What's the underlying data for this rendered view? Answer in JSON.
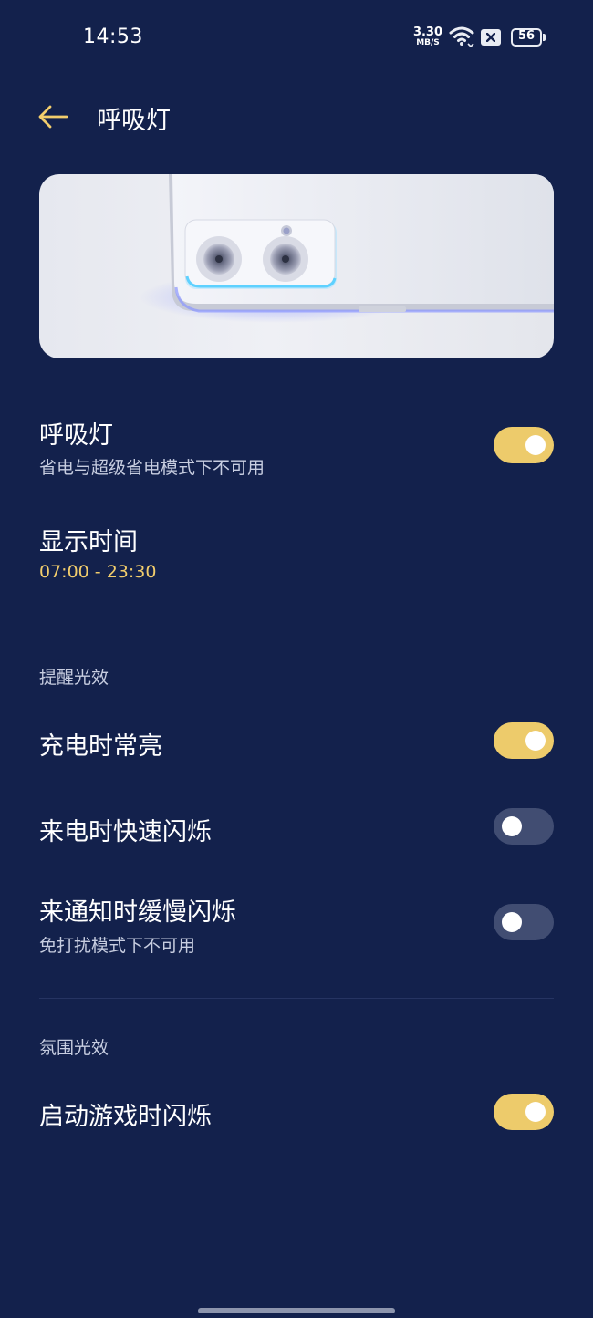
{
  "status_bar": {
    "time": "14:53",
    "net_speed_value": "3.30",
    "net_speed_unit": "MB/S",
    "battery": "56",
    "icons": [
      "wifi-icon",
      "sim-blocked-icon",
      "battery-icon"
    ]
  },
  "header": {
    "back_icon": "arrow-left-icon",
    "title": "呼吸灯"
  },
  "hero": {
    "image": "phone-camera-breathing-light-illustration"
  },
  "settings": {
    "breathing_light": {
      "title": "呼吸灯",
      "subtitle": "省电与超级省电模式下不可用",
      "enabled": true
    },
    "display_time": {
      "title": "显示时间",
      "value": "07:00 - 23:30"
    }
  },
  "sections": {
    "reminder": {
      "header": "提醒光效",
      "items": [
        {
          "title": "充电时常亮",
          "enabled": true
        },
        {
          "title": "来电时快速闪烁",
          "enabled": false
        },
        {
          "title": "来通知时缓慢闪烁",
          "subtitle": "免打扰模式下不可用",
          "enabled": false
        }
      ]
    },
    "ambient": {
      "header": "氛围光效",
      "items": [
        {
          "title": "启动游戏时闪烁",
          "enabled": true
        }
      ]
    }
  },
  "colors": {
    "background": "#13214c",
    "accent": "#edcb6b",
    "toggle_off": "#414d72",
    "time_text": "#f2cd6c",
    "secondary_text": "#c7cde0"
  }
}
